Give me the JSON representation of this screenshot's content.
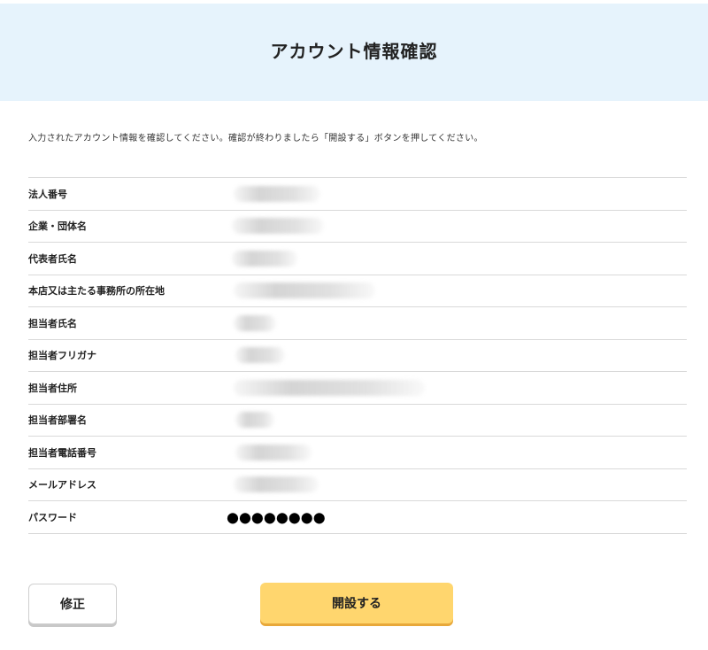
{
  "header": {
    "title": "アカウント情報確認"
  },
  "instruction": "入力されたアカウント情報を確認してください。確認が終わりましたら「開設する」ボタンを押してください。",
  "rows": [
    {
      "label": "法人番号",
      "value_visible": false
    },
    {
      "label": "企業・団体名",
      "value_visible": false
    },
    {
      "label": "代表者氏名",
      "value_visible": false
    },
    {
      "label": "本店又は主たる事務所の所在地",
      "value_visible": false
    },
    {
      "label": "担当者氏名",
      "value_visible": false
    },
    {
      "label": "担当者フリガナ",
      "value_visible": false
    },
    {
      "label": "担当者住所",
      "value_visible": false
    },
    {
      "label": "担当者部署名",
      "value_visible": false
    },
    {
      "label": "担当者電話番号",
      "value_visible": false
    },
    {
      "label": "メールアドレス",
      "value_visible": false
    },
    {
      "label": "パスワード",
      "value": "●●●●●●●●"
    }
  ],
  "buttons": {
    "fix_label": "修正",
    "open_label": "開設する"
  },
  "colors": {
    "header_bg": "#e6f3fc",
    "primary_button": "#ffd66e",
    "primary_button_shadow": "#e8a83a"
  }
}
